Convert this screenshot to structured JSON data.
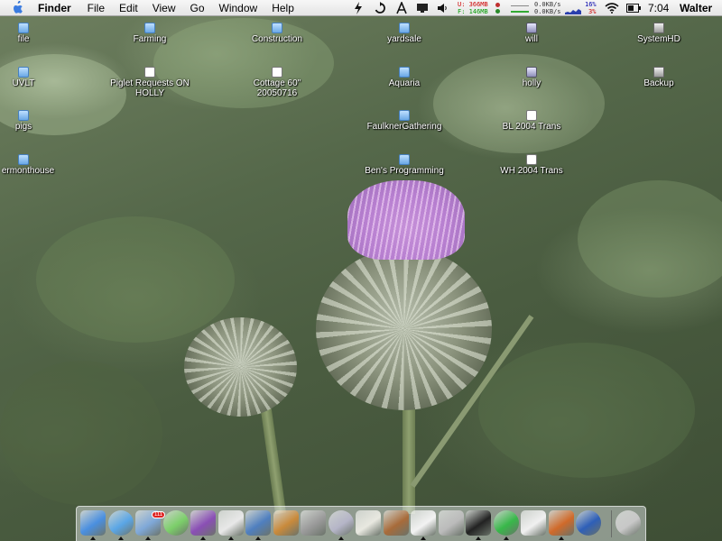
{
  "menubar": {
    "app_name": "Finder",
    "menus": [
      "File",
      "Edit",
      "View",
      "Go",
      "Window",
      "Help"
    ],
    "memory_used": "U: 366MB",
    "memory_free": "F: 146MB",
    "net_up": "0.0KB/s",
    "net_down": "0.0KB/s",
    "cpu_user": "16%",
    "cpu_sys": "3%",
    "clock": "7:04",
    "user": "Walter",
    "status_icons": [
      "script-icon",
      "sync-icon",
      "airport-icon",
      "display-icon",
      "volume-icon",
      "wifi-icon",
      "battery-icon"
    ]
  },
  "desktop": {
    "icons": [
      {
        "label": "file",
        "kind": "folder"
      },
      {
        "label": "Farming",
        "kind": "folder"
      },
      {
        "label": "Construction",
        "kind": "folder"
      },
      {
        "label": "yardsale",
        "kind": "folder"
      },
      {
        "label": "will",
        "kind": "server"
      },
      {
        "label": "SystemHD",
        "kind": "disk"
      },
      {
        "label": "UVLT",
        "kind": "folder"
      },
      {
        "label": "Piglet Requests ON HOLLY",
        "kind": "doc"
      },
      {
        "label": "Cottage 60\" 20050716",
        "kind": "doc"
      },
      {
        "label": "Aquaria",
        "kind": "folder"
      },
      {
        "label": "holly",
        "kind": "server"
      },
      {
        "label": "Backup",
        "kind": "disk"
      },
      {
        "label": "pigs",
        "kind": "folder"
      },
      {
        "label": "FaulknerGathering",
        "kind": "folder"
      },
      {
        "label": "BL 2004 Trans",
        "kind": "doc"
      },
      {
        "label": "ermonthouse",
        "kind": "folder"
      },
      {
        "label": "Ben's Programming",
        "kind": "folder"
      },
      {
        "label": "WH 2004 Trans",
        "kind": "doc"
      }
    ]
  },
  "dock": {
    "mail_badge": "111",
    "items": [
      "finder",
      "safari",
      "mail",
      "itunes",
      "iphoto",
      "panda",
      "preview",
      "address-book",
      "calculator",
      "disk-utility",
      "textedit",
      "chipmunk",
      "font-book",
      "system-profiler",
      "terminal",
      "cube",
      "ical",
      "firefox",
      "bbedit",
      "trash"
    ],
    "colors": {
      "finder": "#4a8fe0",
      "safari": "#5aa6e6",
      "mail": "#7fa8d8",
      "itunes": "#7ccf6a",
      "iphoto": "#8a4fb5",
      "panda": "#e8e8e8",
      "preview": "#4f7fbf",
      "address-book": "#c98a3b",
      "calculator": "#9a9a9a",
      "disk-utility": "#b5b5c8",
      "textedit": "#e8e8e0",
      "chipmunk": "#a86b3a",
      "font-book": "#f2f2f2",
      "system-profiler": "#bbbbbb",
      "terminal": "#222222",
      "cube": "#38b84a",
      "ical": "#f0f0f0",
      "firefox": "#d06a2a",
      "bbedit": "#2e5fb8",
      "trash": "#c8c8c8"
    }
  }
}
